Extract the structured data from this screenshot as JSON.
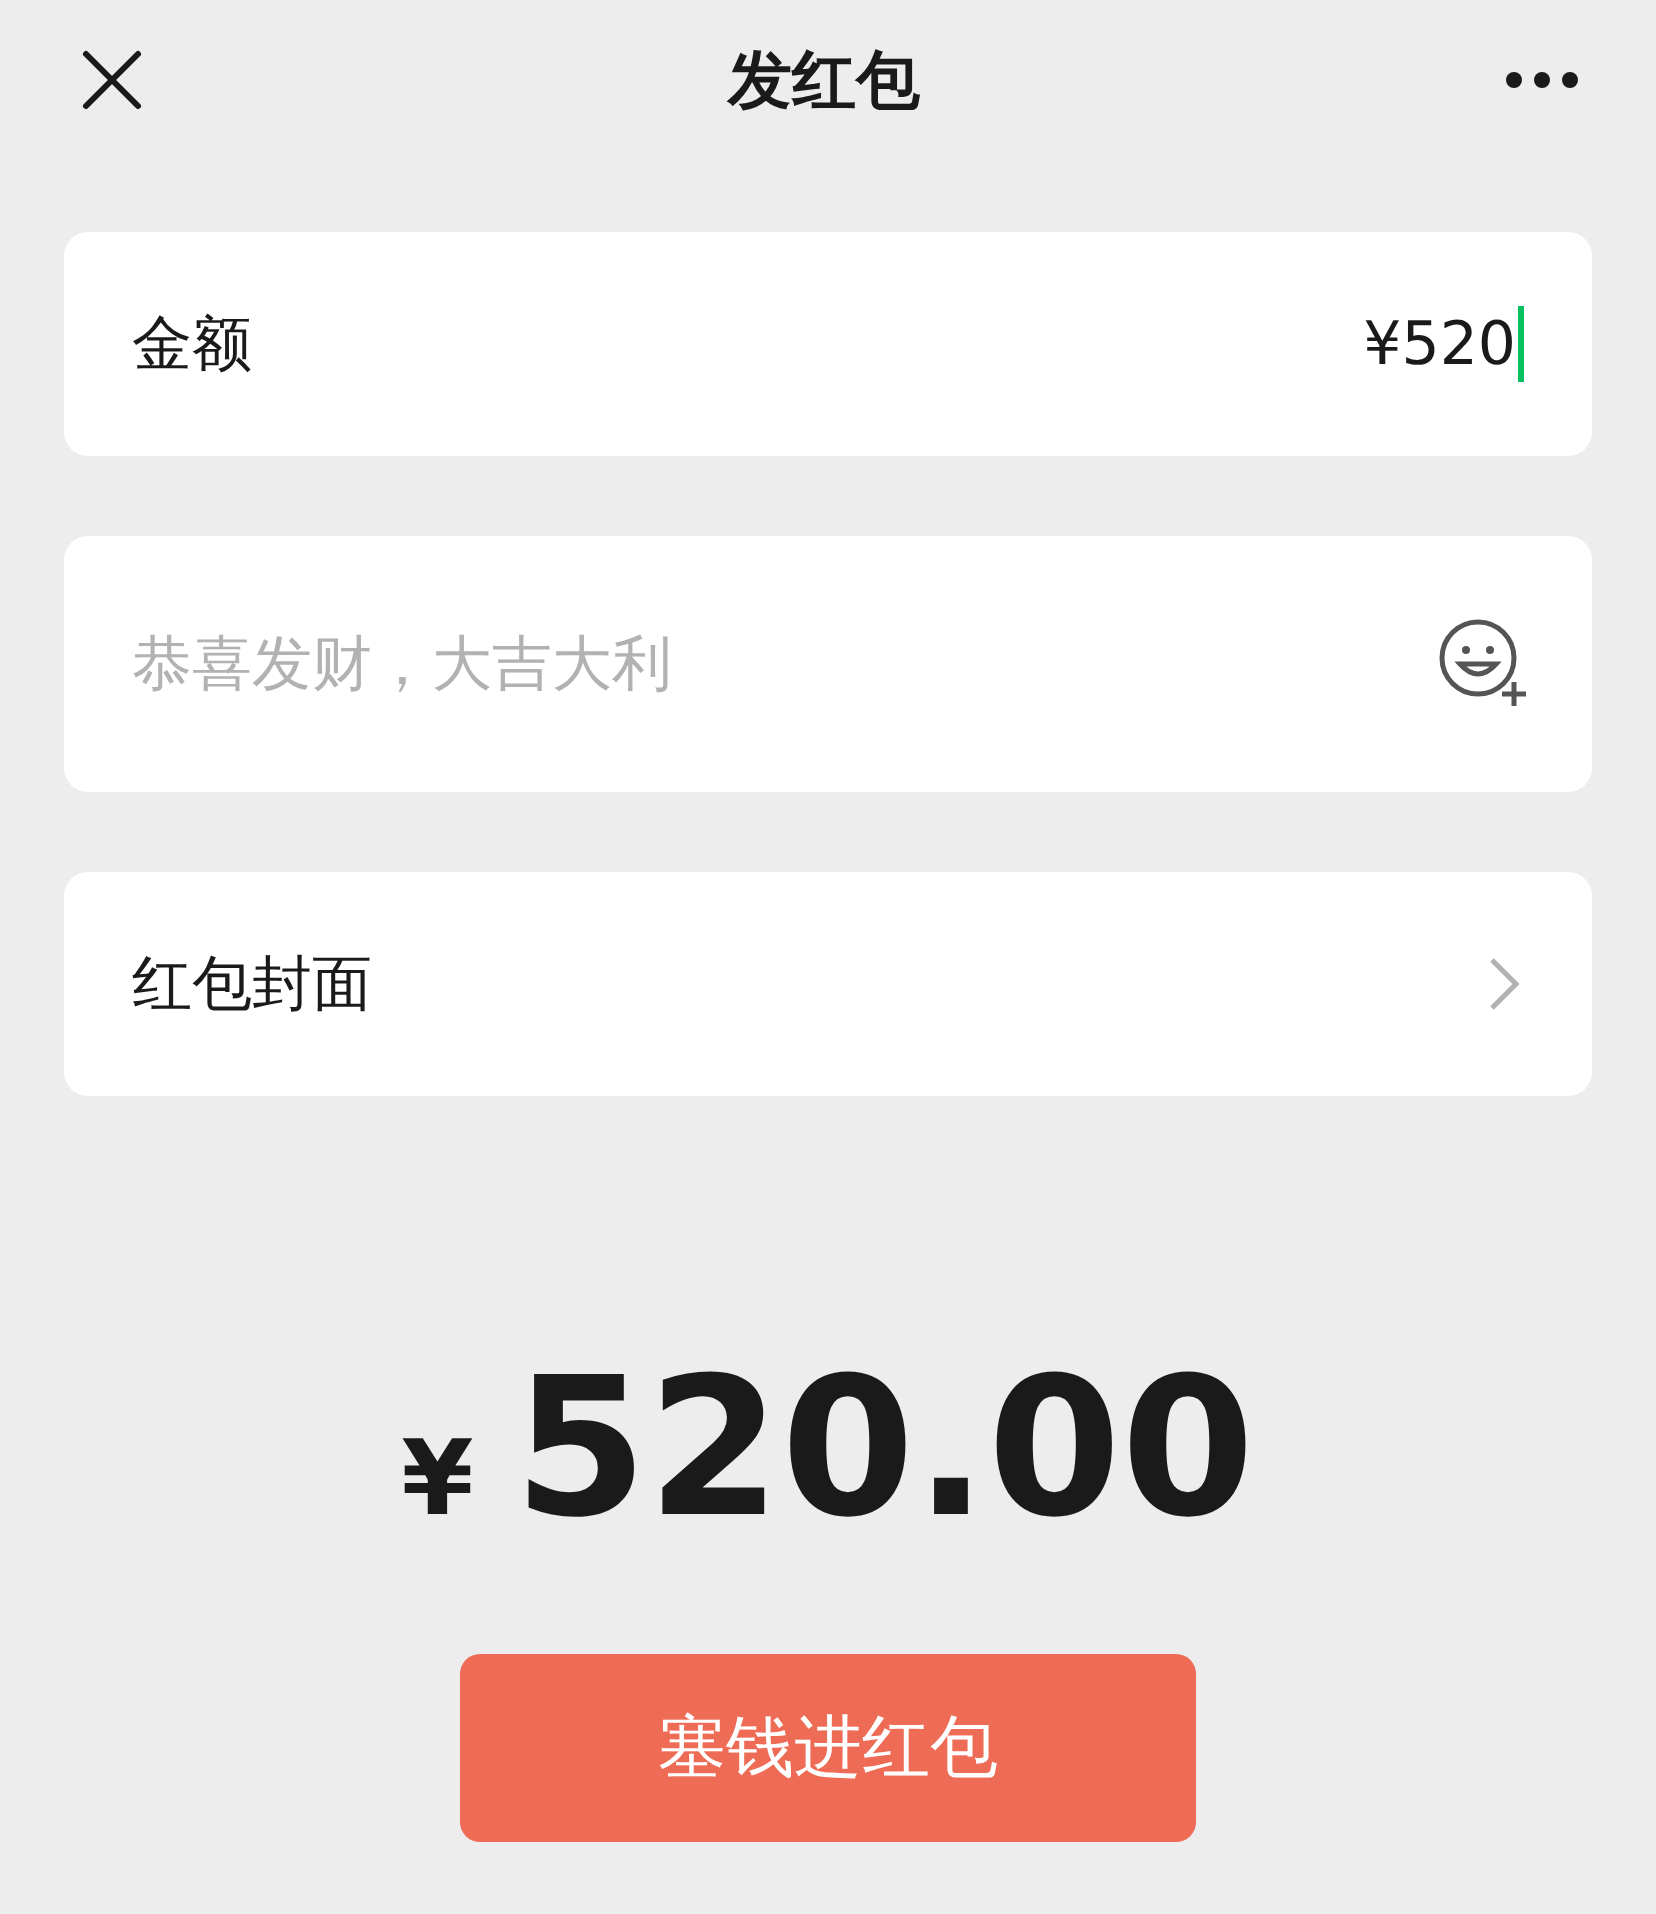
{
  "header": {
    "title": "发红包"
  },
  "amount_field": {
    "label": "金额",
    "value": "¥520",
    "focused": true
  },
  "greeting_field": {
    "placeholder": "恭喜发财，大吉大利"
  },
  "cover_row": {
    "label": "红包封面"
  },
  "total": {
    "currency": "¥",
    "amount": "520.00"
  },
  "submit_button": {
    "label": "塞钱进红包"
  }
}
